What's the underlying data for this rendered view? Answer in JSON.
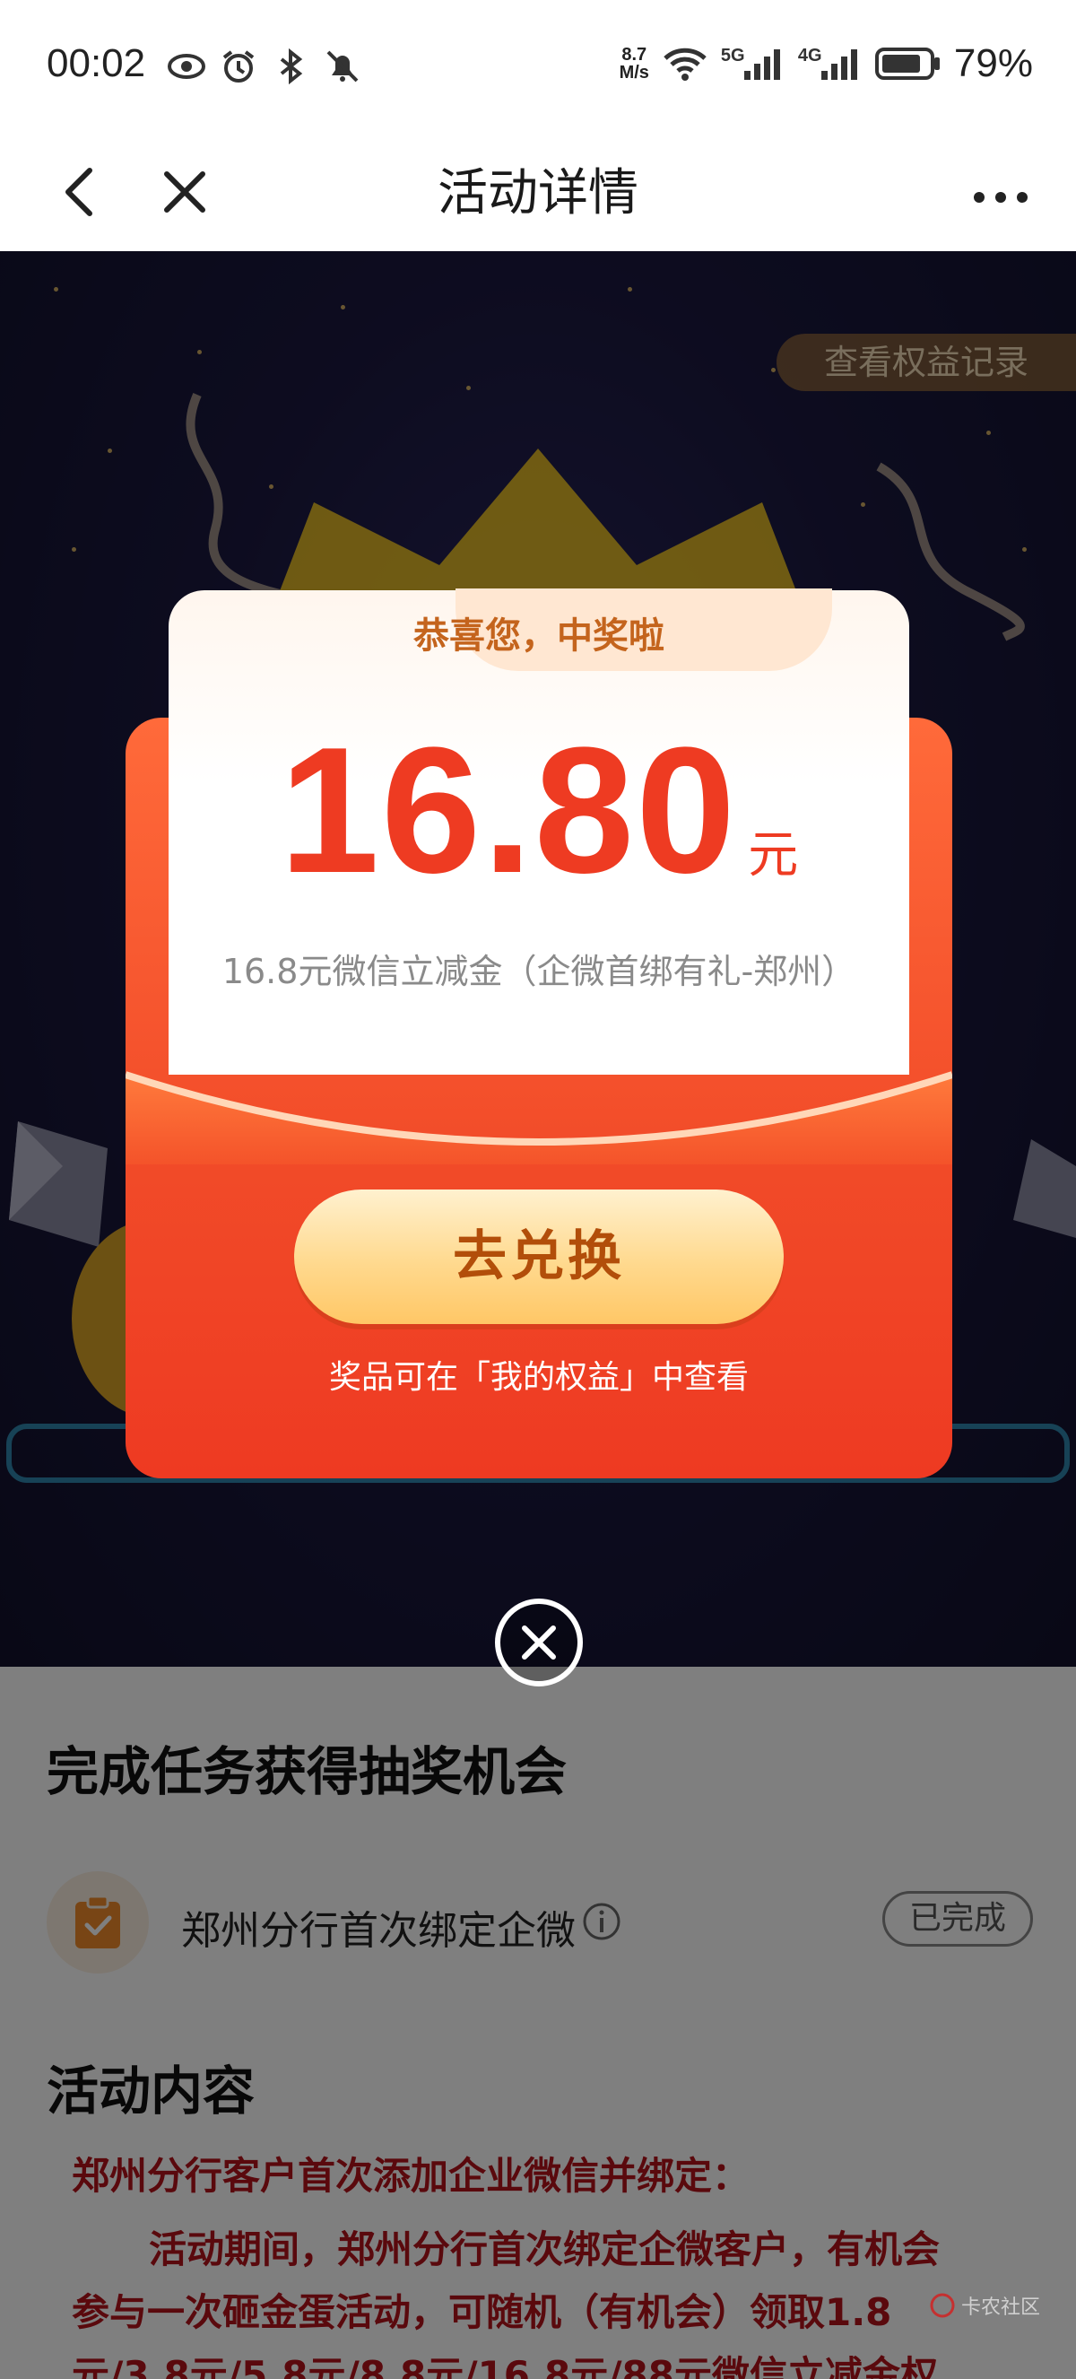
{
  "status_bar": {
    "time": "00:02",
    "net_speed_value": "8.7",
    "net_speed_unit": "M/s",
    "network_5g": "5G",
    "network_4g": "4G",
    "battery": "79%"
  },
  "nav": {
    "title": "活动详情"
  },
  "hero": {
    "records_label": "查看权益记录"
  },
  "modal": {
    "congrats": "恭喜您，中奖啦",
    "amount": "16.80",
    "unit": "元",
    "prize_desc": "16.8元微信立减金（企微首绑有礼-郑州）",
    "redeem_label": "去兑换",
    "note": "奖品可在「我的权益」中查看"
  },
  "content": {
    "tasks_title": "完成任务获得抽奖机会",
    "task_label": "郑州分行首次绑定企微",
    "task_status": "已完成",
    "activity_title": "活动内容",
    "desc_heading": "郑州分行客户首次添加企业微信并绑定：",
    "desc_line1": "活动期间，郑州分行首次绑定企微客户，有机会",
    "desc_line2": "参与一次砸金蛋活动，可随机（有机会）领取1.8",
    "desc_line3": "元/3.8元/5.8元/8.8元/16.8元/88元微信立减金权"
  },
  "watermark": "卡农社区",
  "colors": {
    "accent_red": "#ee3b22",
    "description_red": "#b5121b",
    "button_gold": "#ffd98e",
    "hero_bg": "#1b1940"
  },
  "icons": {
    "back": "back-arrow-icon",
    "close_nav": "close-icon",
    "more": "more-dots-icon",
    "close_modal": "close-circle-icon",
    "task": "clipboard-check-icon",
    "info": "info-icon"
  }
}
